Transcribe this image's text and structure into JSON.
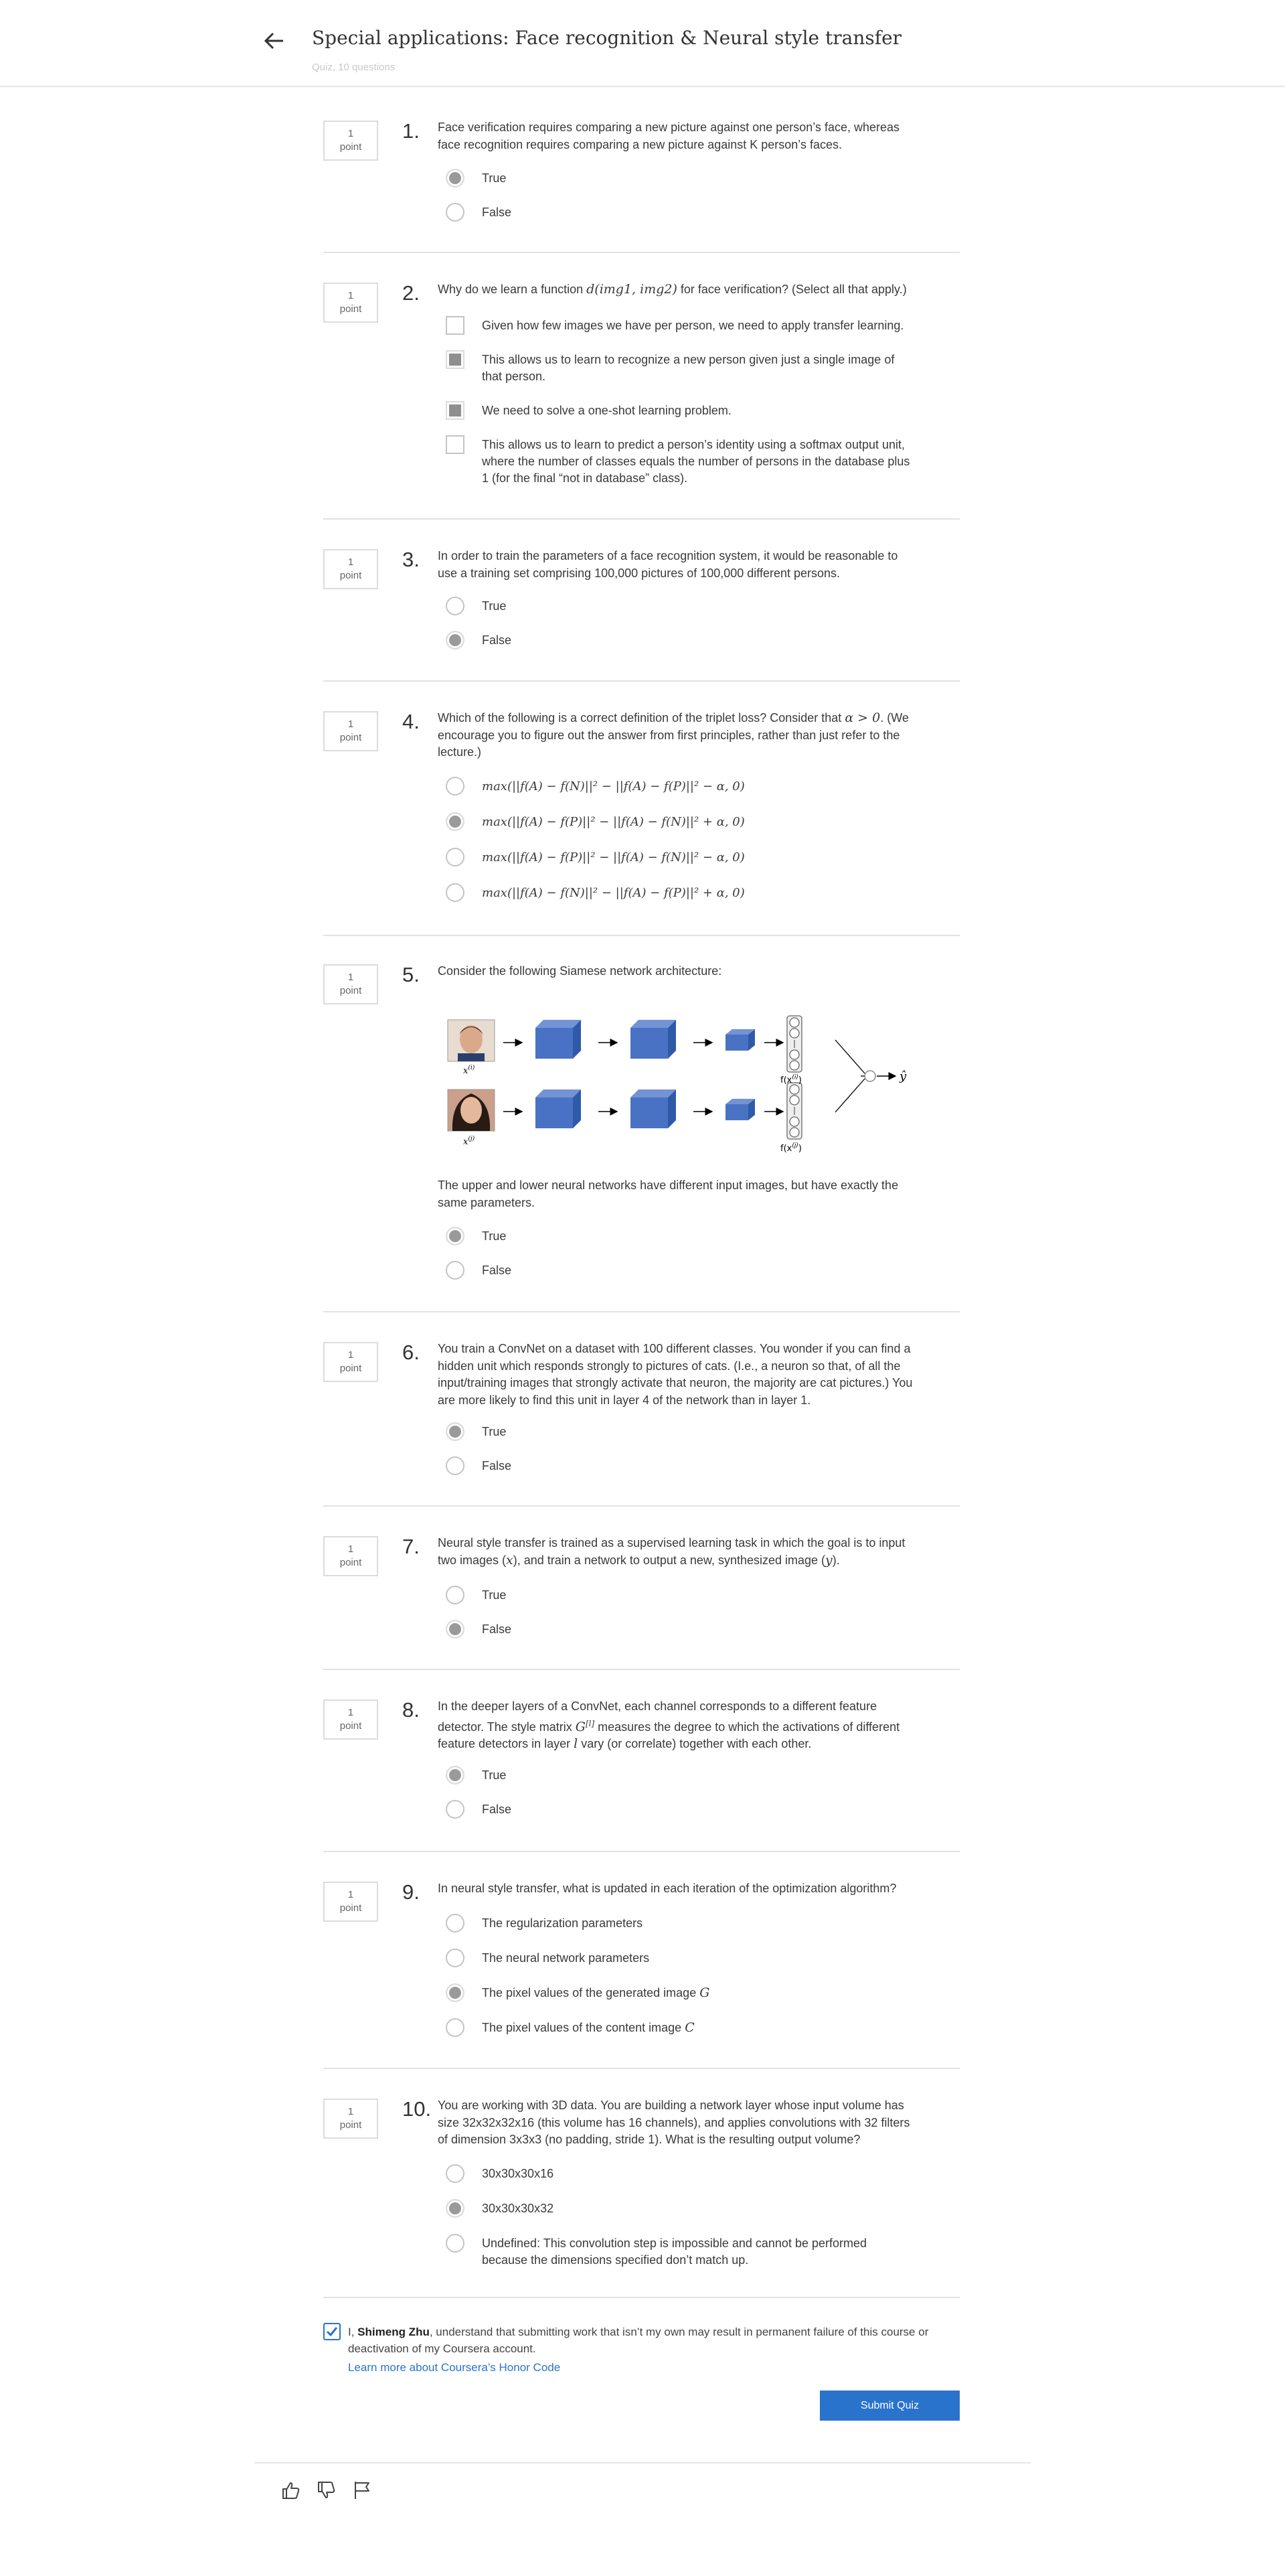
{
  "header": {
    "title": "Special applications: Face recognition & Neural style transfer",
    "subtitle": "Quiz, 10 questions"
  },
  "questions": [
    {
      "number": "1.",
      "points": "1",
      "points_label": "point",
      "text": "Face verification requires comparing a new picture against one person’s face, whereas face recognition requires comparing a new picture against K person’s faces.",
      "options": [
        {
          "label": "True",
          "selected": true
        },
        {
          "label": "False",
          "selected": false
        }
      ]
    },
    {
      "number": "2.",
      "points": "1",
      "points_label": "point",
      "text_before": "Why do we learn a function ",
      "text_math": "d(img1, img2)",
      "text_after": " for face verification? (Select all that apply.)",
      "options": [
        {
          "label": "Given how few images we have per person, we need to apply transfer learning.",
          "selected": false
        },
        {
          "label": "This allows us to learn to recognize a new person given just a single image of that person.",
          "selected": true
        },
        {
          "label": "We need to solve a one-shot learning problem.",
          "selected": true
        },
        {
          "label": "This allows us to learn to predict a person’s identity using a softmax output unit, where the number of classes equals the number of persons in the database plus 1 (for the final “not in database” class).",
          "selected": false
        }
      ]
    },
    {
      "number": "3.",
      "points": "1",
      "points_label": "point",
      "text": "In order to train the parameters of a face recognition system, it would be reasonable to use a training set comprising 100,000 pictures of 100,000 different persons.",
      "options": [
        {
          "label": "True",
          "selected": false
        },
        {
          "label": "False",
          "selected": true
        }
      ]
    },
    {
      "number": "4.",
      "points": "1",
      "points_label": "point",
      "text_before": "Which of the following is a correct definition of the triplet loss? Consider that ",
      "text_math": "α > 0",
      "text_after": ". (We encourage you to figure out the answer from first principles, rather than just refer to the lecture.)",
      "options": [
        {
          "label": "max(||f(A) − f(N)||² − ||f(A) − f(P)||² − α, 0)",
          "selected": false
        },
        {
          "label": "max(||f(A) − f(P)||² − ||f(A) − f(N)||² + α, 0)",
          "selected": true
        },
        {
          "label": "max(||f(A) − f(P)||² − ||f(A) − f(N)||² − α, 0)",
          "selected": false
        },
        {
          "label": "max(||f(A) − f(N)||² − ||f(A) − f(P)||² + α, 0)",
          "selected": false
        }
      ]
    },
    {
      "number": "5.",
      "points": "1",
      "points_label": "point",
      "text": "Consider the following Siamese network architecture:",
      "figure": {
        "input_top": "x",
        "input_top_sup": "(i)",
        "input_bottom": "x",
        "input_bottom_sup": "(j)",
        "out_top": "f(x",
        "out_top_sup": "(i)",
        "out_bottom": "f(x",
        "out_bottom_sup": "(j)",
        "output": "ŷ",
        "close_paren": ")"
      },
      "text2": "The upper and lower neural networks have different input images, but have exactly the same parameters.",
      "options": [
        {
          "label": "True",
          "selected": true
        },
        {
          "label": "False",
          "selected": false
        }
      ]
    },
    {
      "number": "6.",
      "points": "1",
      "points_label": "point",
      "text": "You train a ConvNet on a dataset with 100 different classes. You wonder if you can find a hidden unit which responds strongly to pictures of cats. (I.e., a neuron so that, of all the input/training images that strongly activate that neuron, the majority are cat pictures.) You are more likely to find this unit in layer 4 of the network than in layer 1.",
      "options": [
        {
          "label": "True",
          "selected": true
        },
        {
          "label": "False",
          "selected": false
        }
      ]
    },
    {
      "number": "7.",
      "points": "1",
      "points_label": "point",
      "text_before": "Neural style transfer is trained as a supervised learning task in which the goal is to input two images (",
      "text_math": "x",
      "text_after": "), and train a network to output a new, synthesized image (",
      "text_math2": "y",
      "text_end": ").",
      "options": [
        {
          "label": "True",
          "selected": false
        },
        {
          "label": "False",
          "selected": true
        }
      ]
    },
    {
      "number": "8.",
      "points": "1",
      "points_label": "point",
      "text_before": "In the deeper layers of a ConvNet, each channel corresponds to a different feature detector. The style matrix ",
      "text_math": "G",
      "text_math_sup": "[l]",
      "text_after": " measures the degree to which the activations of different feature detectors in layer ",
      "text_math2": "l",
      "text_end": " vary (or correlate) together with each other.",
      "options": [
        {
          "label": "True",
          "selected": true
        },
        {
          "label": "False",
          "selected": false
        }
      ]
    },
    {
      "number": "9.",
      "points": "1",
      "points_label": "point",
      "text": "In neural style transfer, what is updated in each iteration of the optimization algorithm?",
      "options": [
        {
          "label": "The regularization parameters",
          "selected": false
        },
        {
          "label": "The neural network parameters",
          "selected": false
        },
        {
          "label": "The pixel values of the generated image ",
          "math": "G",
          "selected": true
        },
        {
          "label": "The pixel values of the content image ",
          "math": "C",
          "selected": false
        }
      ]
    },
    {
      "number": "10.",
      "points": "1",
      "points_label": "point",
      "text": "You are working with 3D data. You are building a network layer whose input volume has size 32x32x32x16 (this volume has 16 channels), and applies convolutions with 32 filters of dimension 3x3x3 (no padding, stride 1). What is the resulting output volume?",
      "options": [
        {
          "label": "30x30x30x16",
          "selected": false
        },
        {
          "label": "30x30x30x32",
          "selected": true
        },
        {
          "label": "Undefined: This convolution step is impossible and cannot be performed because the dimensions specified don’t match up.",
          "selected": false
        }
      ]
    }
  ],
  "honor": {
    "prefix": "I, ",
    "name": "Shimeng Zhu",
    "statement": ", understand that submitting work that isn’t my own may result in permanent failure of this course or deactivation of my Coursera account.",
    "link": "Learn more about Coursera’s Honor Code",
    "checked": true
  },
  "submit_label": "Submit Quiz",
  "icons": [
    "back-arrow-icon",
    "thumbs-up-icon",
    "thumbs-down-icon",
    "flag-icon",
    "checkmark-icon"
  ],
  "colors": {
    "accent": "#2a73cc",
    "cube": "#4a72c4"
  }
}
